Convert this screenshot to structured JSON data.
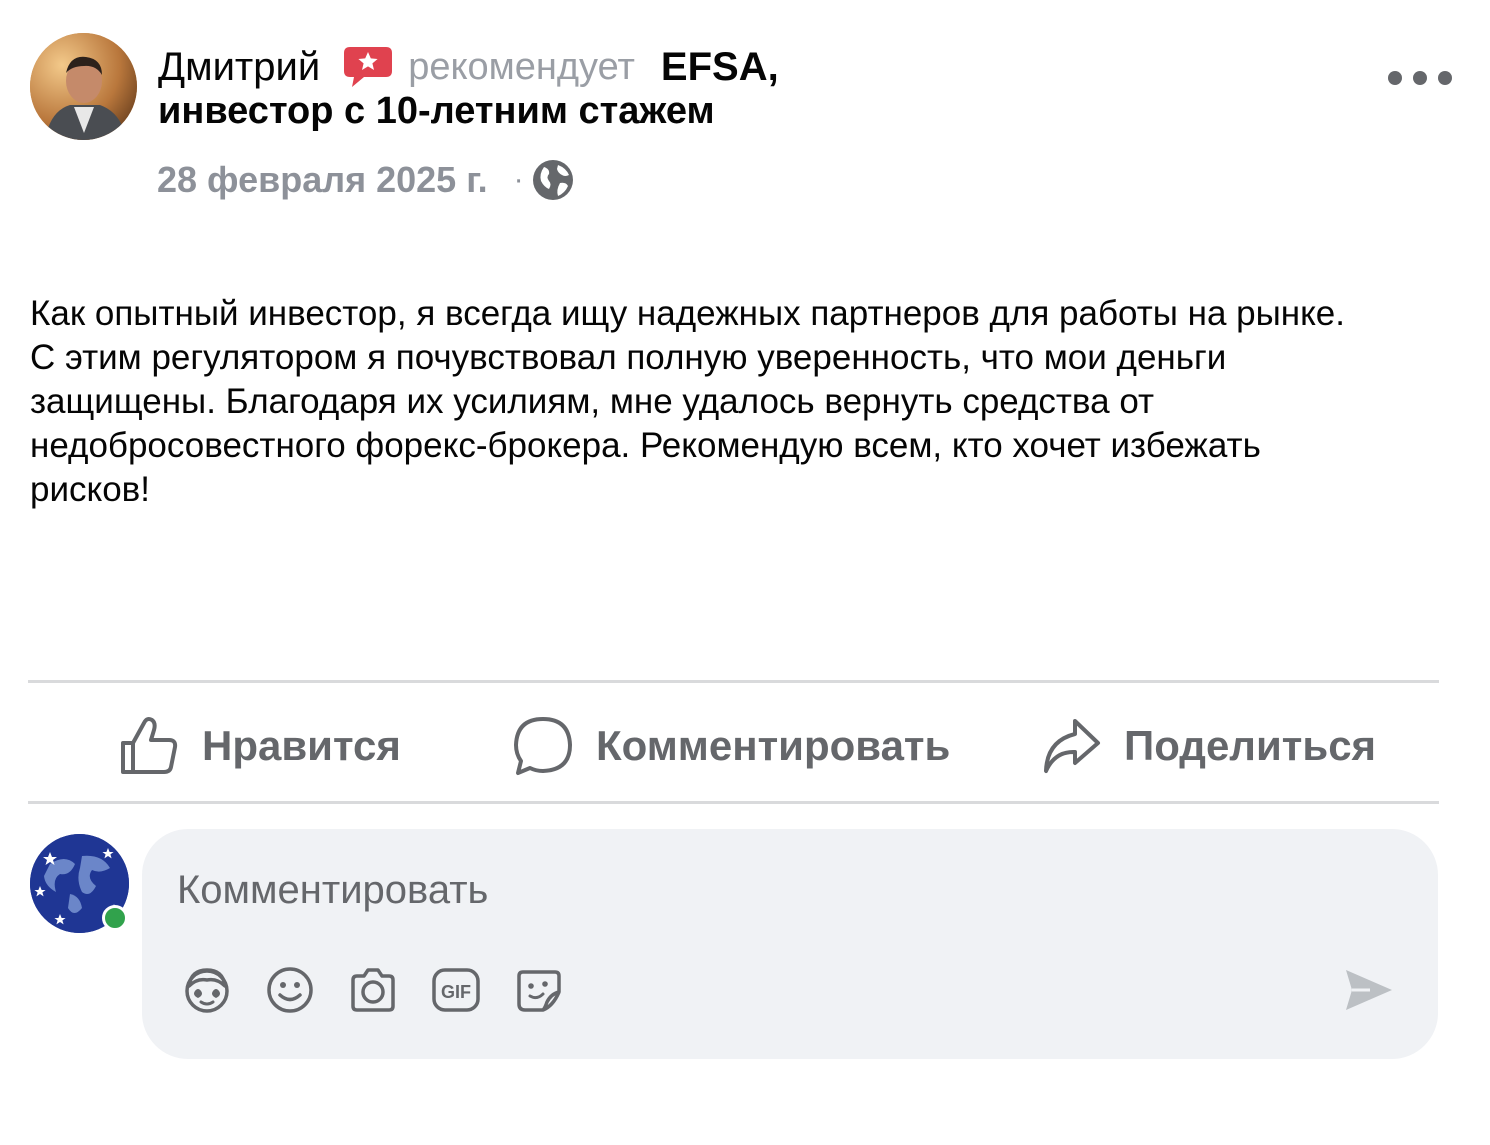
{
  "post": {
    "author_name": "Дмитрий",
    "recommends_word": "рекомендует",
    "recommended_target": "EFSA,",
    "author_title": "инвестор с 10-летним стажем",
    "date": "28 февраля 2025 г.",
    "dot_separator": "·",
    "body": "Как опытный инвестор, я всегда ищу надежных партнеров для работы на рынке.\nС этим регулятором я почувствовал полную уверенность, что мои деньги\nзащищены. Благодаря их усилиям, мне удалось вернуть средства от\nнедобросовестного форекс-брокера. Рекомендую всем, кто хочет избежать\nрисков!"
  },
  "actions": {
    "like_label": "Нравится",
    "comment_label": "Комментировать",
    "share_label": "Поделиться"
  },
  "composer": {
    "placeholder": "Комментировать",
    "tools": [
      "avatar-sticker-icon",
      "emoji-icon",
      "camera-icon",
      "gif-icon",
      "sticker-icon"
    ],
    "send_icon": "send-icon"
  },
  "colors": {
    "text_primary": "#050505",
    "text_secondary": "#65676b",
    "recommend_badge": "#e0424f",
    "online": "#31a24c",
    "composer_bg": "#f0f2f5"
  }
}
